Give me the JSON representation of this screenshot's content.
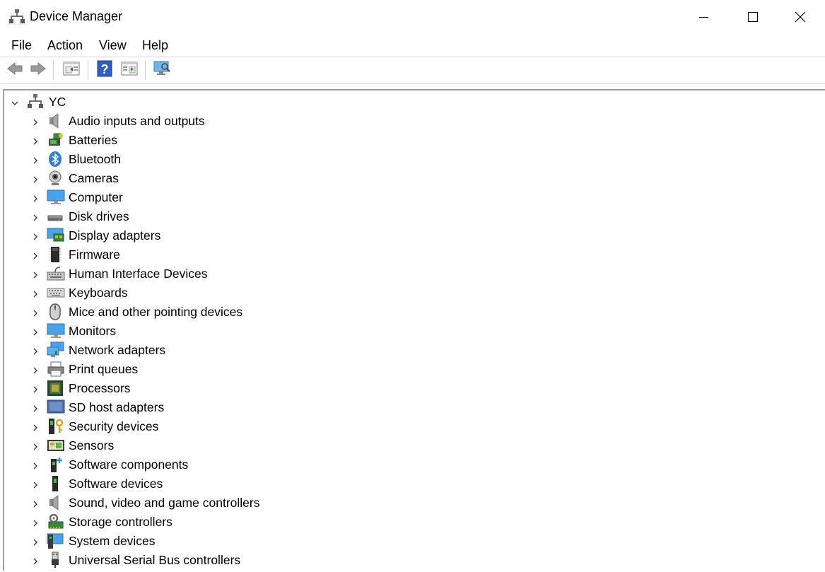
{
  "window": {
    "title": "Device Manager",
    "title_icon": "device-manager-icon",
    "controls": [
      "minimize-icon",
      "maximize-icon",
      "close-icon"
    ]
  },
  "menubar": {
    "items": [
      "File",
      "Action",
      "View",
      "Help"
    ]
  },
  "toolbar": {
    "buttons": [
      "back-arrow-icon",
      "forward-arrow-icon",
      "properties-icon",
      "help-icon",
      "show-hide-pane-icon",
      "scan-hardware-icon"
    ]
  },
  "tree": {
    "root": {
      "label": "YC",
      "icon": "computer-network-icon",
      "expanded": true
    },
    "categories": [
      {
        "label": "Audio inputs and outputs",
        "icon": "speaker-icon"
      },
      {
        "label": "Batteries",
        "icon": "battery-icon"
      },
      {
        "label": "Bluetooth",
        "icon": "bluetooth-icon"
      },
      {
        "label": "Cameras",
        "icon": "webcam-icon"
      },
      {
        "label": "Computer",
        "icon": "monitor-icon"
      },
      {
        "label": "Disk drives",
        "icon": "disk-drive-icon"
      },
      {
        "label": "Display adapters",
        "icon": "display-adapter-icon"
      },
      {
        "label": "Firmware",
        "icon": "firmware-chip-icon"
      },
      {
        "label": "Human Interface Devices",
        "icon": "hid-keyboard-icon"
      },
      {
        "label": "Keyboards",
        "icon": "keyboard-icon"
      },
      {
        "label": "Mice and other pointing devices",
        "icon": "mouse-icon"
      },
      {
        "label": "Monitors",
        "icon": "monitor-icon"
      },
      {
        "label": "Network adapters",
        "icon": "network-adapter-icon"
      },
      {
        "label": "Print queues",
        "icon": "printer-icon"
      },
      {
        "label": "Processors",
        "icon": "processor-icon"
      },
      {
        "label": "SD host adapters",
        "icon": "sd-card-icon"
      },
      {
        "label": "Security devices",
        "icon": "security-key-icon"
      },
      {
        "label": "Sensors",
        "icon": "sensor-icon"
      },
      {
        "label": "Software components",
        "icon": "software-component-icon"
      },
      {
        "label": "Software devices",
        "icon": "software-device-icon"
      },
      {
        "label": "Sound, video and game controllers",
        "icon": "speaker-icon"
      },
      {
        "label": "Storage controllers",
        "icon": "storage-controller-icon"
      },
      {
        "label": "System devices",
        "icon": "system-device-icon"
      },
      {
        "label": "Universal Serial Bus controllers",
        "icon": "usb-icon"
      }
    ]
  },
  "colors": {
    "window_bg": "#ffffff",
    "border": "#a0a0a0",
    "icon_blue": "#3a8ee6"
  }
}
